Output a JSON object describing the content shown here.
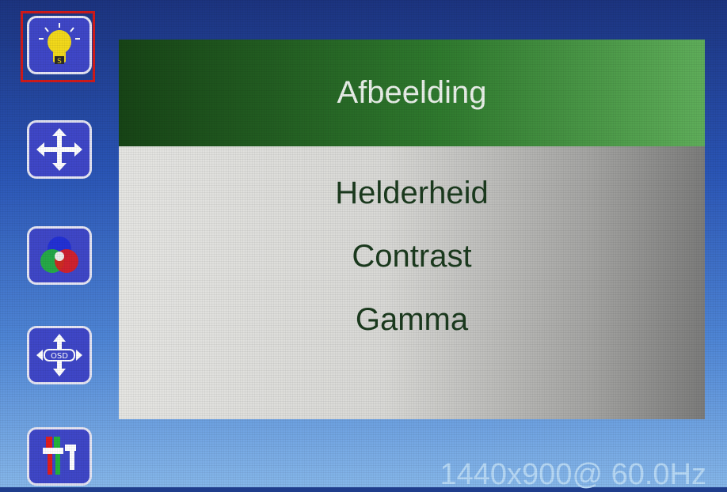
{
  "sidebar": {
    "items": [
      {
        "id": "picture",
        "icon": "lightbulb-icon",
        "selected": true
      },
      {
        "id": "position",
        "icon": "move-arrows-icon",
        "selected": false
      },
      {
        "id": "color",
        "icon": "rgb-circles-icon",
        "selected": false
      },
      {
        "id": "osd",
        "icon": "osd-position-icon",
        "selected": false
      },
      {
        "id": "setup",
        "icon": "tools-icon",
        "selected": false
      }
    ]
  },
  "panel": {
    "title": "Afbeelding",
    "items": [
      {
        "label": "Helderheid"
      },
      {
        "label": "Contrast"
      },
      {
        "label": "Gamma"
      }
    ]
  },
  "status": {
    "resolution": "1440x900@ 60.0Hz"
  },
  "colors": {
    "selection_border": "#d11a1a",
    "title_bar": "#2f7a2e",
    "menu_text": "#1b3a1e",
    "status_text": "#b7d9f6"
  }
}
